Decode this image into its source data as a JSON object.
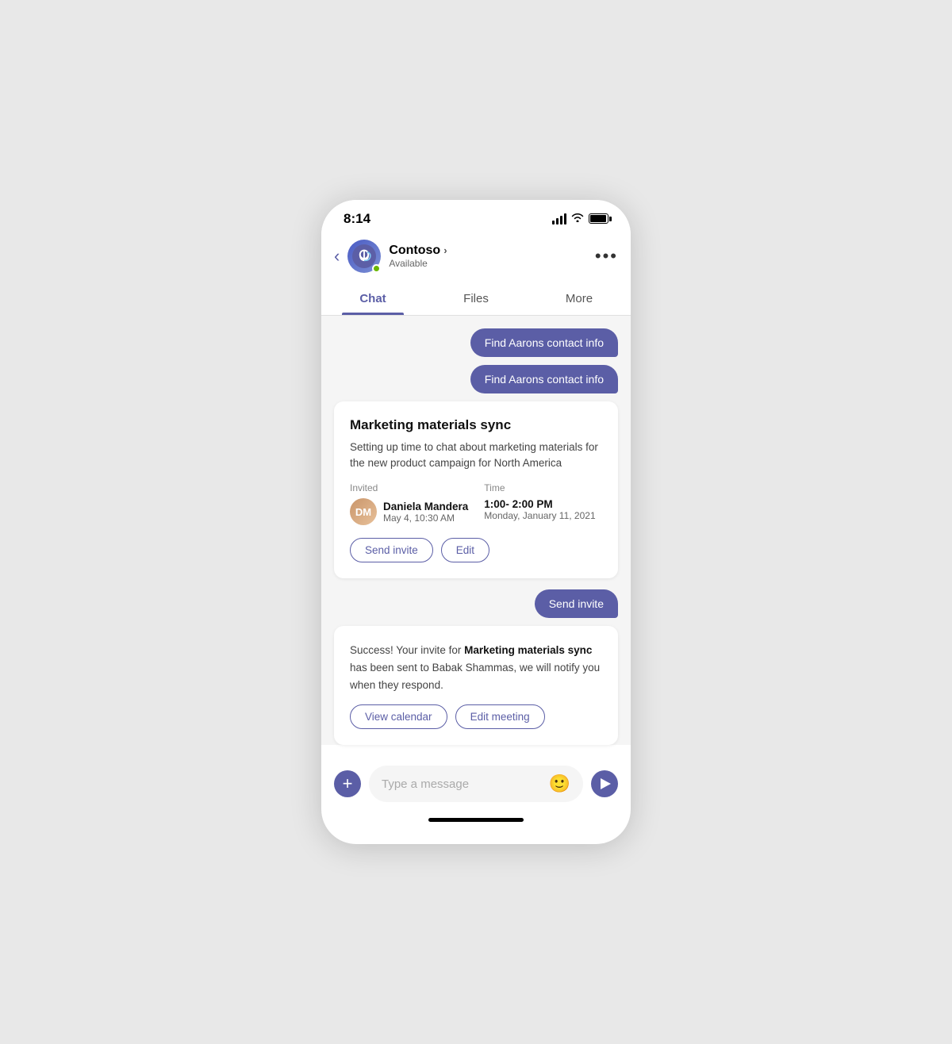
{
  "statusBar": {
    "time": "8:14"
  },
  "header": {
    "backLabel": "‹",
    "name": "Contoso",
    "nameChevron": "›",
    "status": "Available",
    "moreLabel": "•••"
  },
  "tabs": [
    {
      "label": "Chat",
      "active": true
    },
    {
      "label": "Files",
      "active": false
    },
    {
      "label": "More",
      "active": false
    }
  ],
  "chat": {
    "bubbles": [
      {
        "text": "Find Aarons contact info"
      },
      {
        "text": "Find Aarons contact info"
      }
    ],
    "meetingCard": {
      "title": "Marketing materials sync",
      "description": "Setting up time to chat about marketing materials for the new product campaign for North America",
      "invitedLabel": "Invited",
      "timeLabel": "Time",
      "inviteeName": "Daniela Mandera",
      "inviteeDate": "May 4, 10:30 AM",
      "timeMain": "1:00- 2:00 PM",
      "timeDate": "Monday, January 11, 2021",
      "sendInviteLabel": "Send invite",
      "editLabel": "Edit"
    },
    "sendInviteBubble": "Send invite",
    "successCard": {
      "text1": "Success! Your invite for ",
      "boldText": "Marketing materials sync",
      "text2": " has been sent to Babak Shammas, we will notify you when they respond.",
      "viewCalendarLabel": "View calendar",
      "editMeetingLabel": "Edit meeting"
    }
  },
  "inputBar": {
    "placeholder": "Type a message",
    "addLabel": "+",
    "sendLabel": "send"
  }
}
